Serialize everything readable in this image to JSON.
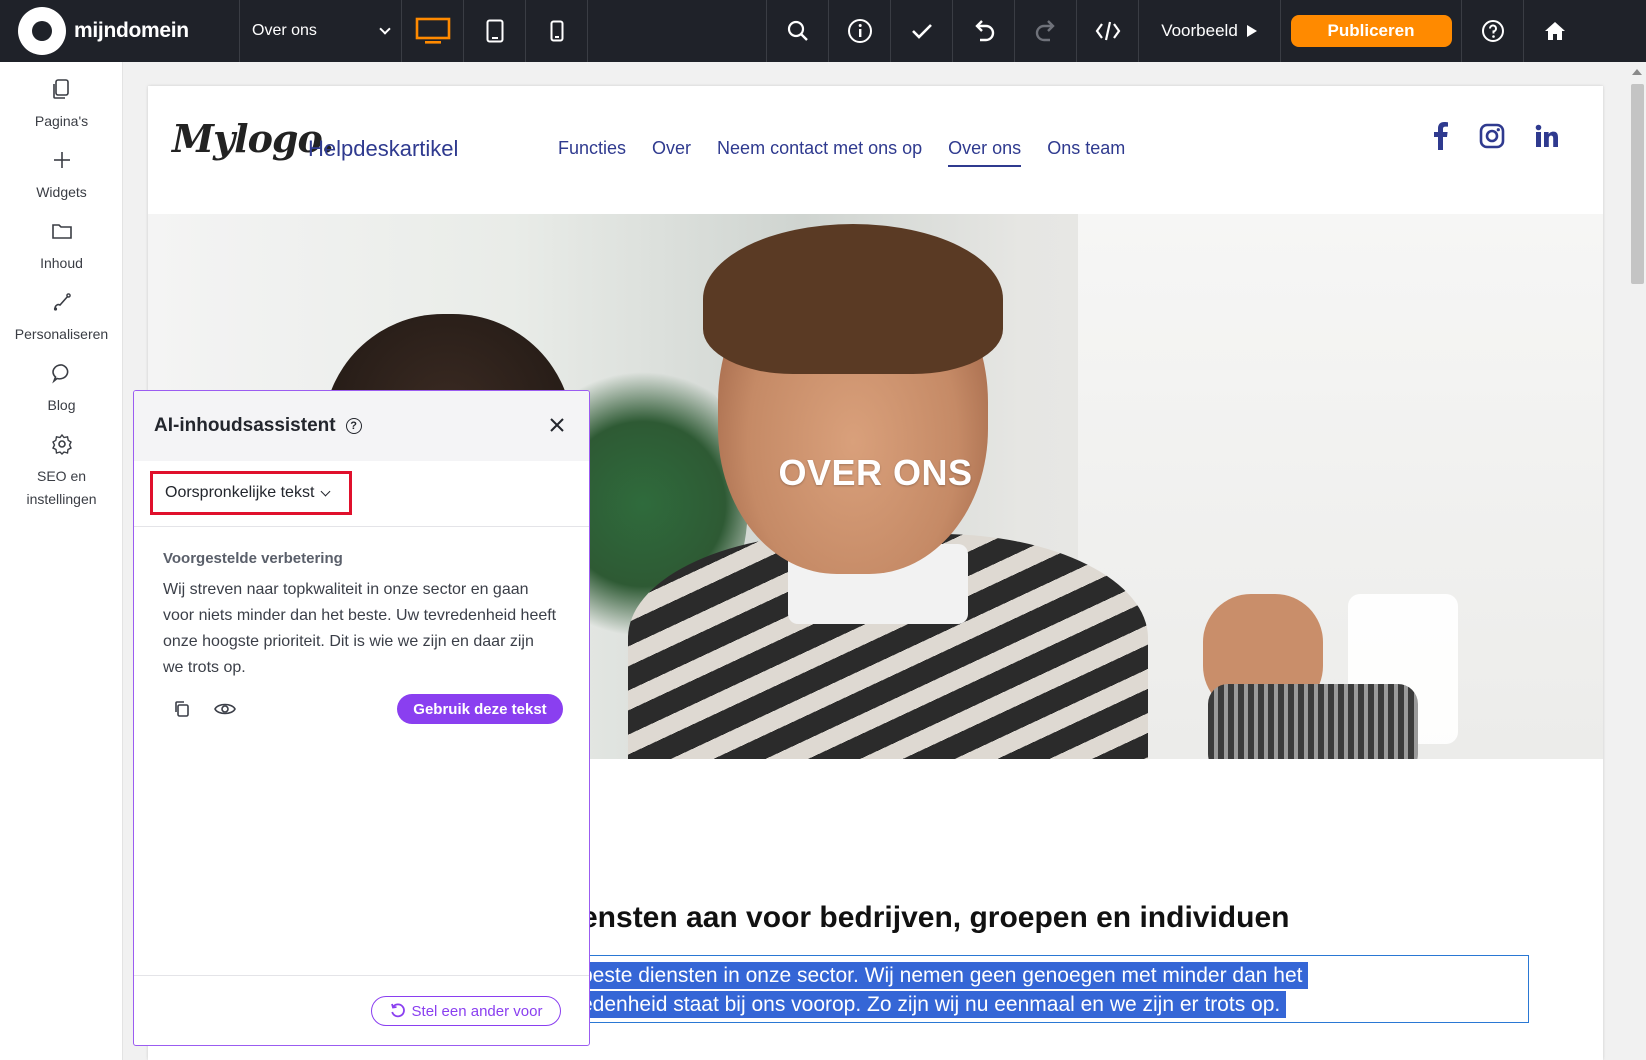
{
  "topbar": {
    "brand_name": "mijndomein",
    "page_select_value": "Over ons",
    "preview_label": "Voorbeeld",
    "publish_label": "Publiceren",
    "accent_color": "#ff8a00",
    "device_icons": [
      "desktop-icon",
      "tablet-icon",
      "mobile-icon"
    ],
    "tool_icons": [
      "search-icon",
      "info-icon",
      "check-icon",
      "undo-icon",
      "redo-icon",
      "code-icon"
    ],
    "end_icons": [
      "help-icon",
      "home-icon"
    ]
  },
  "leftnav": {
    "items": [
      {
        "label": "Pagina's",
        "icon": "pages-icon"
      },
      {
        "label": "Widgets",
        "icon": "plus-icon"
      },
      {
        "label": "Inhoud",
        "icon": "folder-icon"
      },
      {
        "label": "Personaliseren",
        "icon": "brush-icon"
      },
      {
        "label": "Blog",
        "icon": "chat-icon"
      },
      {
        "label": "SEO en instellingen",
        "icon": "gear-icon"
      }
    ]
  },
  "site": {
    "logo_text": "Mylogo.",
    "title": "Helpdeskartikel",
    "nav": [
      "Functies",
      "Over",
      "Neem contact met ons op",
      "Over ons",
      "Ons team"
    ],
    "active_nav": "Over ons",
    "socials": [
      "facebook-icon",
      "instagram-icon",
      "linkedin-icon"
    ],
    "hero_title": "OVER ONS",
    "section_heading": "ensten aan voor bedrijven, groepen en individuen",
    "selected_lines": [
      "beste diensten in onze sector. Wij nemen geen genoegen met minder dan het",
      "edenheid staat bij ons voorop. Zo zijn wij nu eenmaal en we zijn er trots op."
    ]
  },
  "ai_panel": {
    "title": "AI-inhoudsassistent",
    "dropdown_value": "Oorspronkelijke tekst",
    "suggestion_label": "Voorgestelde verbetering",
    "suggestion_text": "Wij streven naar topkwaliteit in onze sector en gaan voor niets minder dan het beste. Uw tevredenheid heeft onze hoogste prioriteit. Dit is wie we zijn en daar zijn we trots op.",
    "use_button": "Gebruik deze tekst",
    "retry_button": "Stel een ander voor",
    "accent_color": "#8a3ff0"
  }
}
